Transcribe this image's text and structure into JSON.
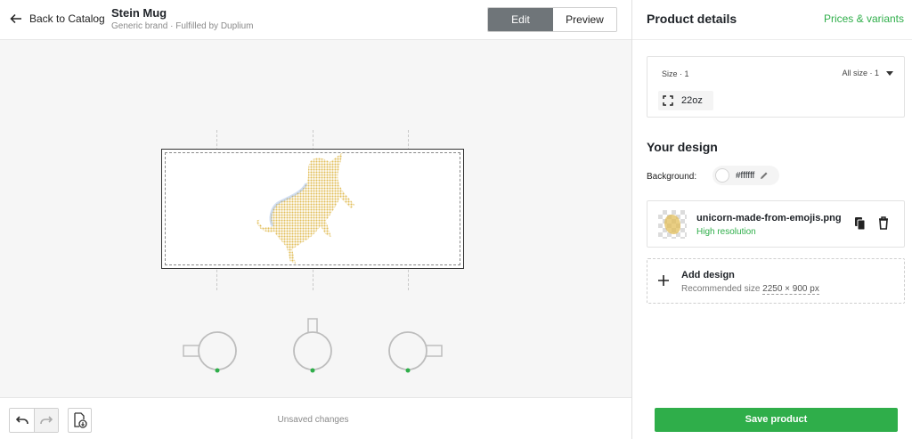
{
  "header": {
    "back_label": "Back to Catalog",
    "product_title": "Stein Mug",
    "product_subtitle": "Generic brand · Fulfilled by Duplium",
    "tabs": [
      {
        "label": "Edit",
        "active": true
      },
      {
        "label": "Preview",
        "active": false
      }
    ]
  },
  "canvas": {
    "artwork": "unicorn-made-from-emojis",
    "views": [
      "handle-left",
      "handle-top",
      "handle-right"
    ]
  },
  "footer": {
    "status": "Unsaved changes"
  },
  "panel": {
    "title": "Product details",
    "prices_link": "Prices & variants",
    "size": {
      "label": "Size · 1",
      "filter": "All size · 1",
      "selected": "22oz"
    },
    "design": {
      "heading": "Your design",
      "background_label": "Background:",
      "background_value": "#ffffff",
      "file": {
        "name": "unicorn-made-from-emojis.png",
        "resolution": "High resolution"
      },
      "add": {
        "title": "Add design",
        "recommended_prefix": "Recommended size",
        "recommended_size": "2250 × 900 px"
      }
    },
    "save_label": "Save product"
  },
  "colors": {
    "accent_green": "#2fae4a",
    "edit_tab_bg": "#6f7579",
    "artwork_gold": "#e2be5a"
  }
}
